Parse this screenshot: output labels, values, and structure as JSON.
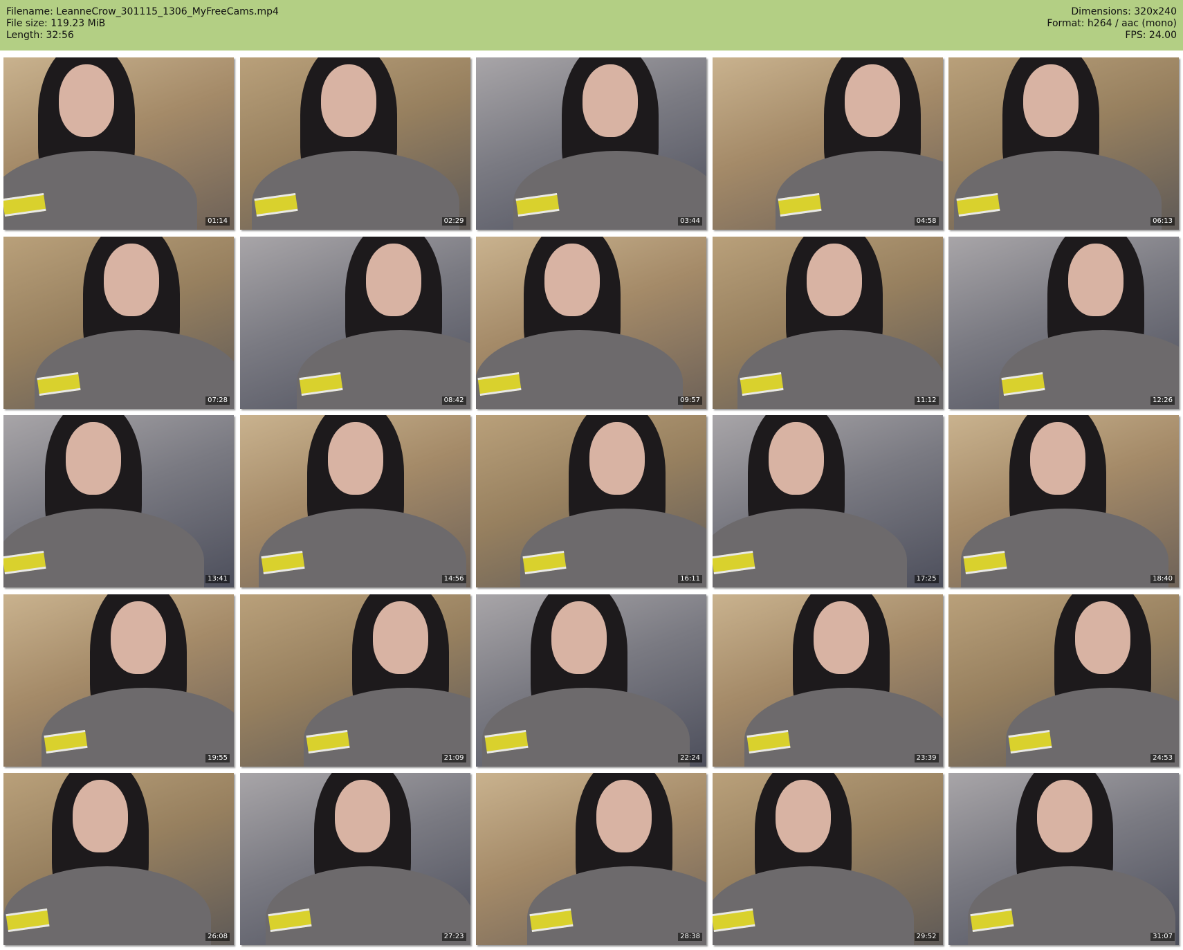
{
  "header": {
    "filename": "Filename: LeanneCrow_301115_1306_MyFreeCams.mp4",
    "filesize": "File size: 119.23 MiB",
    "length": "Length: 32:56",
    "dimensions": "Dimensions: 320x240",
    "format": "Format: h264 / aac (mono)",
    "fps": "FPS: 24.00"
  },
  "colors": {
    "header_bg": "#b3cf84",
    "page_bg": "#ffffff"
  },
  "thumbnails": [
    {
      "time": "01:14"
    },
    {
      "time": "02:29"
    },
    {
      "time": "03:44"
    },
    {
      "time": "04:58"
    },
    {
      "time": "06:13"
    },
    {
      "time": "07:28"
    },
    {
      "time": "08:42"
    },
    {
      "time": "09:57"
    },
    {
      "time": "11:12"
    },
    {
      "time": "12:26"
    },
    {
      "time": "13:41"
    },
    {
      "time": "14:56"
    },
    {
      "time": "16:11"
    },
    {
      "time": "17:25"
    },
    {
      "time": "18:40"
    },
    {
      "time": "19:55"
    },
    {
      "time": "21:09"
    },
    {
      "time": "22:24"
    },
    {
      "time": "23:39"
    },
    {
      "time": "24:53"
    },
    {
      "time": "26:08"
    },
    {
      "time": "27:23"
    },
    {
      "time": "28:38"
    },
    {
      "time": "29:52"
    },
    {
      "time": "31:07"
    }
  ]
}
